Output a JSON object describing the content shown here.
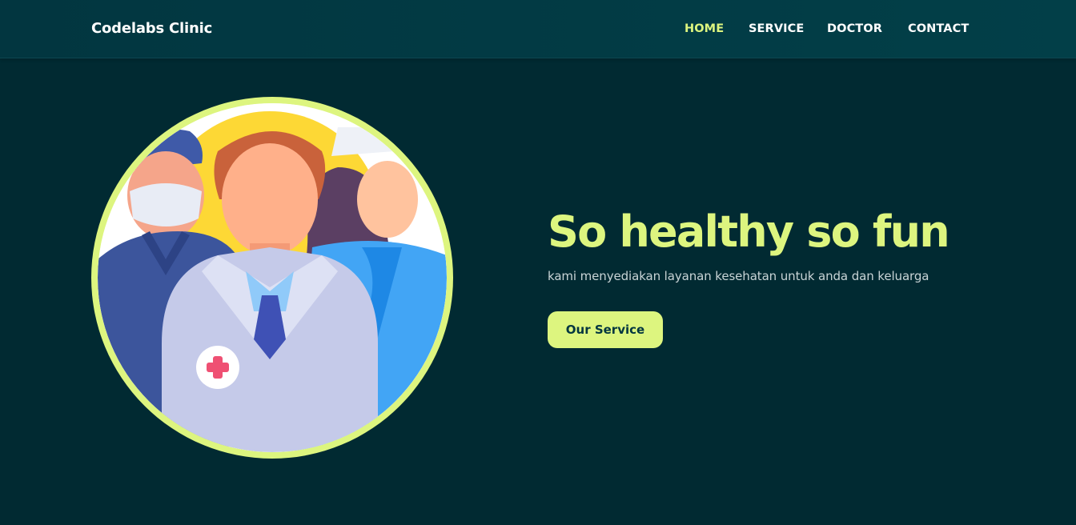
{
  "navbar": {
    "brand": "Codelabs Clinic",
    "links": [
      {
        "label": "HOME",
        "active": true
      },
      {
        "label": "SERVICE",
        "active": false
      },
      {
        "label": "DOCTOR",
        "active": false
      },
      {
        "label": "CONTACT",
        "active": false
      }
    ]
  },
  "hero": {
    "headline": "So healthy so fun",
    "subtitle": "kami menyediakan layanan kesehatan untuk anda dan keluarga",
    "cta_label": "Our Service",
    "image_icon": "medical-team-illustration"
  },
  "colors": {
    "background": "#012a32",
    "navbar": "#023f48",
    "accent": "#ddf57f",
    "subtitle_text": "#c9d4d6"
  }
}
